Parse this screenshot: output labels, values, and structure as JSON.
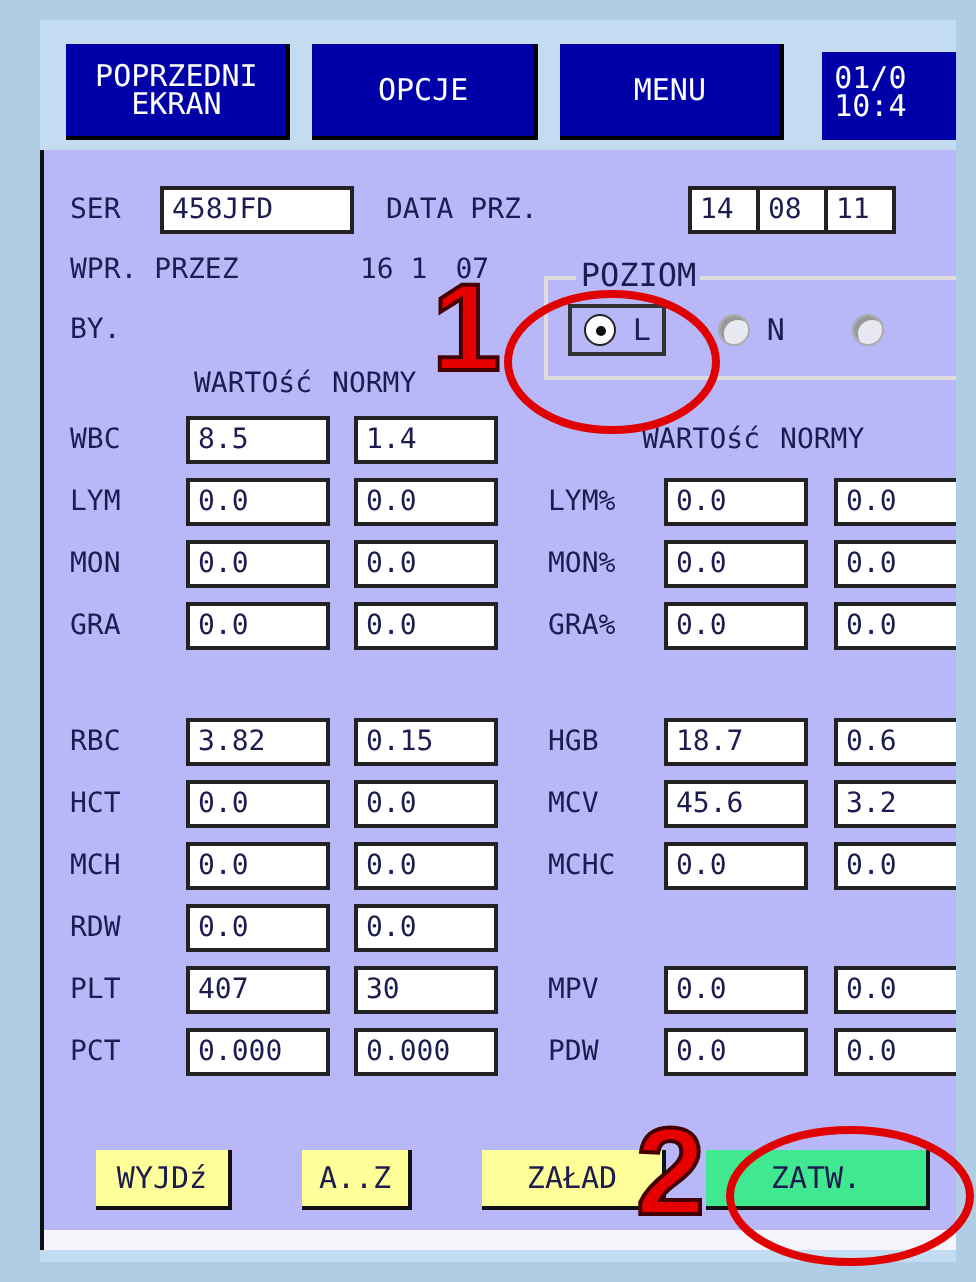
{
  "top_buttons": [
    {
      "lines": [
        "POPRZEDNI",
        "EKRAN"
      ]
    },
    {
      "lines": [
        "OPCJE"
      ]
    },
    {
      "lines": [
        "MENU"
      ]
    }
  ],
  "clock": [
    "01/0",
    "10:4"
  ],
  "header": {
    "ser_label": "SER",
    "ser_value": "458JFD",
    "date_label": "DATA PRZ.",
    "date_parts": [
      "14",
      "08",
      "11"
    ],
    "entered_label": "WPR. PRZEZ",
    "entered_time": [
      "16 1",
      "07"
    ],
    "by_label": "BY."
  },
  "level_group": {
    "title": "POZIOM",
    "options": [
      {
        "label": "L",
        "selected": true
      },
      {
        "label": "N",
        "selected": false
      },
      {
        "selected": false
      }
    ]
  },
  "left_headers": [
    "WARTOść",
    "NORMY"
  ],
  "groups": [
    {
      "rows": [
        {
          "left": {
            "name": "WBC",
            "value": "8.5",
            "norm": "1.4"
          },
          "right_headers": [
            "WARTOść",
            "NORMY"
          ]
        },
        {
          "left": {
            "name": "LYM",
            "value": "0.0",
            "norm": "0.0"
          },
          "right": {
            "name": "LYM%",
            "value": "0.0",
            "norm": "0.0"
          }
        },
        {
          "left": {
            "name": "MON",
            "value": "0.0",
            "norm": "0.0"
          },
          "right": {
            "name": "MON%",
            "value": "0.0",
            "norm": "0.0"
          }
        },
        {
          "left": {
            "name": "GRA",
            "value": "0.0",
            "norm": "0.0"
          },
          "right": {
            "name": "GRA%",
            "value": "0.0",
            "norm": "0.0"
          }
        }
      ]
    },
    {
      "rows": [
        {
          "left": {
            "name": "RBC",
            "value": "3.82",
            "norm": "0.15"
          },
          "right": {
            "name": "HGB",
            "value": "18.7",
            "norm": "0.6"
          }
        },
        {
          "left": {
            "name": "HCT",
            "value": "0.0",
            "norm": "0.0"
          },
          "right": {
            "name": "MCV",
            "value": "45.6",
            "norm": "3.2"
          }
        },
        {
          "left": {
            "name": "MCH",
            "value": "0.0",
            "norm": "0.0"
          },
          "right": {
            "name": "MCHC",
            "value": "0.0",
            "norm": "0.0"
          }
        },
        {
          "left": {
            "name": "RDW",
            "value": "0.0",
            "norm": "0.0"
          }
        },
        {
          "left": {
            "name": "PLT",
            "value": "407",
            "norm": "30"
          },
          "right": {
            "name": "MPV",
            "value": "0.0",
            "norm": "0.0"
          }
        },
        {
          "left": {
            "name": "PCT",
            "value": "0.000",
            "norm": "0.000"
          },
          "right": {
            "name": "PDW",
            "value": "0.0",
            "norm": "0.0"
          }
        }
      ]
    }
  ],
  "bottom_buttons": [
    {
      "label": "WYJDź",
      "color": "#ffff99"
    },
    {
      "label": "A..Z",
      "color": "#ffff99"
    },
    {
      "label": "ZAŁAD",
      "color": "#ffff99"
    },
    {
      "label": "ZATW.",
      "color": "#40e890"
    }
  ],
  "annotations": [
    {
      "label": "1"
    },
    {
      "label": "2"
    }
  ]
}
